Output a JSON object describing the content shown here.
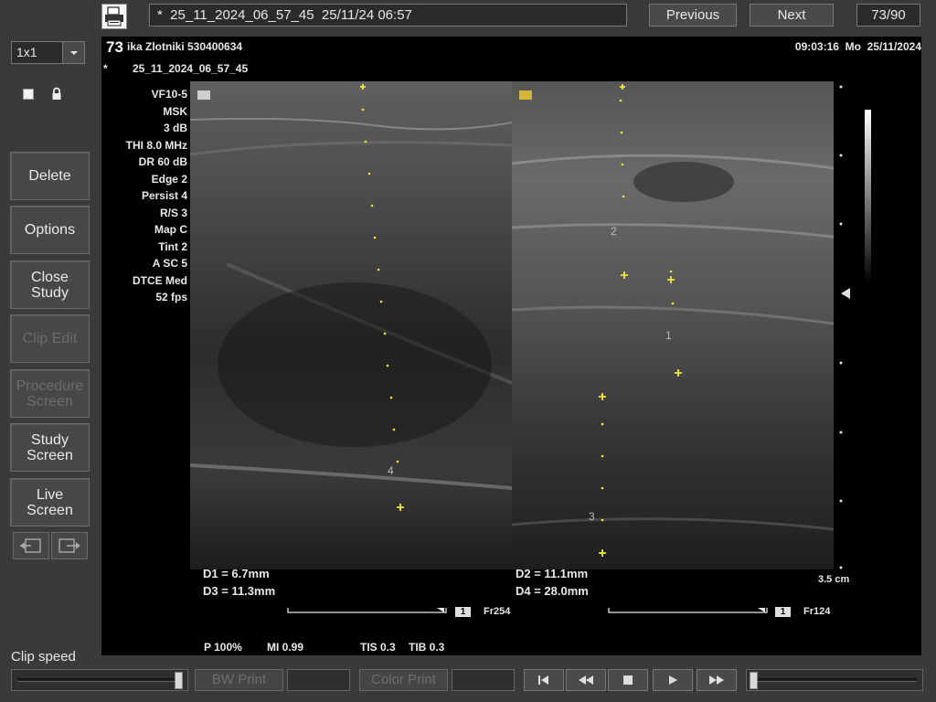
{
  "header": {
    "title": "*  25_11_2024_06_57_45  25/11/24 06:57",
    "previous_label": "Previous",
    "next_label": "Next",
    "counter": "73/90"
  },
  "left_panel": {
    "layout_value": "1x1",
    "buttons": {
      "delete": "Delete",
      "options": "Options",
      "close_study": "Close\nStudy",
      "clip_edit": "Clip Edit",
      "procedure_screen": "Procedure\nScreen",
      "study_screen": "Study\nScreen",
      "live_screen": "Live\nScreen"
    },
    "clip_speed_label": "Clip speed"
  },
  "bottom_bar": {
    "bw_print": "BW Print",
    "color_print": "Color Print",
    "clip_speed_level": 0.97,
    "playback_position": 0.0
  },
  "viewer": {
    "frame_number": "73",
    "patient": "ika Zlotniki 530400634",
    "time": "09:03:16  Mo  25/11/2024",
    "study_marker": "*",
    "study_id": "25_11_2024_06_57_45",
    "params": [
      "VF10-5",
      "MSK",
      "3 dB",
      "THI 8.0 MHz",
      "DR 60 dB",
      "Edge 2",
      "Persist 4",
      "R/S 3",
      "Map C",
      "Tint 2",
      "A SC 5",
      "DTCE Med",
      "52 fps"
    ],
    "measurements": {
      "d1": "D1 = 6.7mm",
      "d3": "D3 = 11.3mm",
      "d2": "D2 = 11.1mm",
      "d4": "D4 = 28.0mm"
    },
    "caliper_labels": [
      "1",
      "2",
      "3",
      "4"
    ],
    "depth": "3.5 cm",
    "left_image": {
      "tag": "1",
      "frame": "Fr254"
    },
    "right_image": {
      "tag": "1",
      "frame": "Fr124"
    },
    "acoustic": {
      "power": "P 100%",
      "mi": "MI 0.99",
      "tis": "TIS 0.3",
      "tib": "TIB 0.3"
    },
    "colors": {
      "caliper": "#f2e63a",
      "text": "#e8e8e8"
    }
  }
}
